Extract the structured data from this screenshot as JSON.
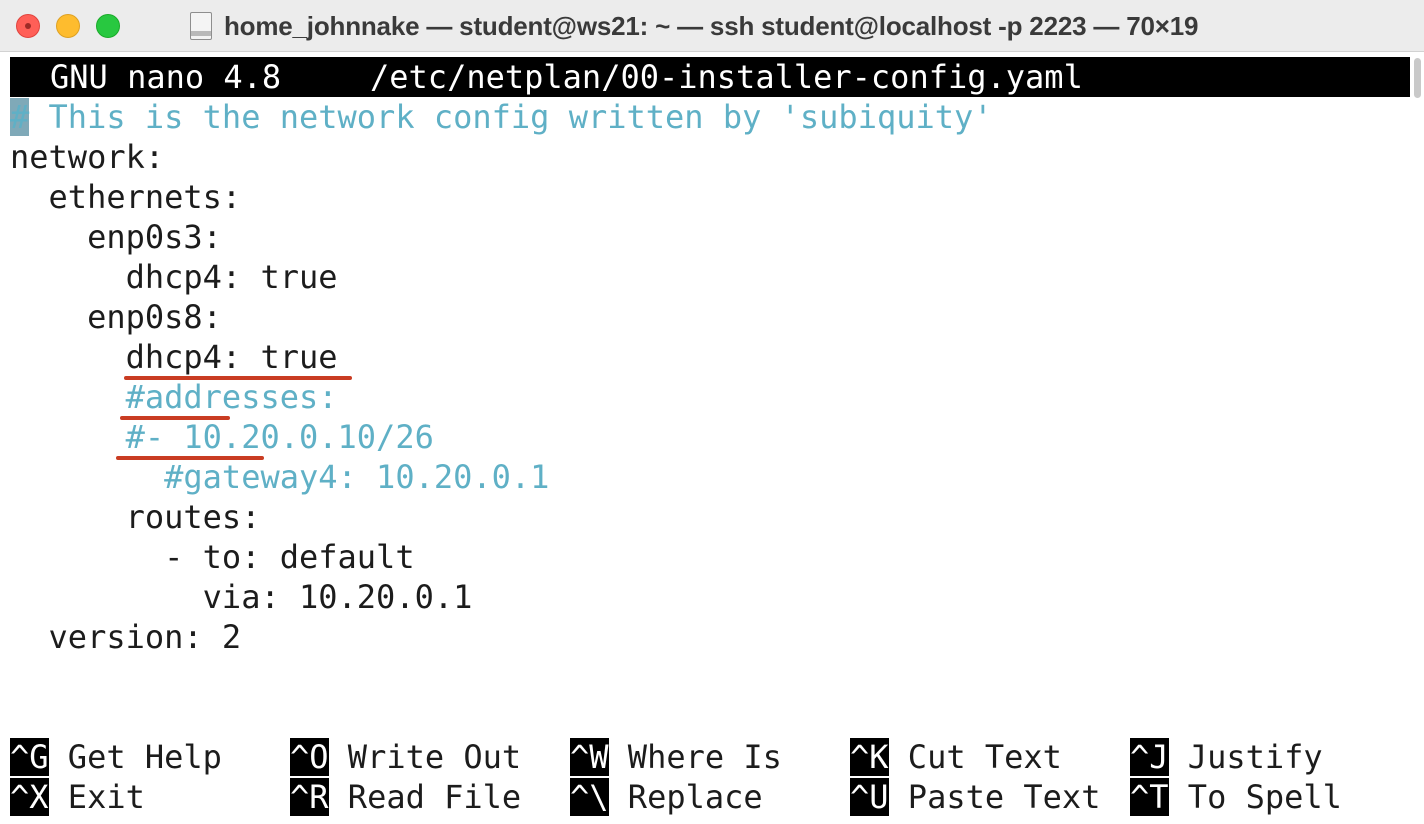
{
  "window": {
    "title": "home_johnnake — student@ws21: ~ — ssh student@localhost -p 2223 — 70×19",
    "icon": "document-icon",
    "traffic_lights": {
      "close": "#ff5f57",
      "minimize": "#febc2e",
      "zoom": "#28c840"
    }
  },
  "nano": {
    "version_label": "GNU nano 4.8",
    "file_path": "/etc/netplan/00-installer-config.yaml"
  },
  "editor": {
    "lines": [
      {
        "prefix": "#",
        "text": " This is the network config written by 'subiquity'",
        "kind": "comment-with-cursor"
      },
      {
        "text": "network:",
        "kind": "code"
      },
      {
        "text": "  ethernets:",
        "kind": "code"
      },
      {
        "text": "    enp0s3:",
        "kind": "code"
      },
      {
        "text": "      dhcp4: true",
        "kind": "code"
      },
      {
        "text": "    enp0s8:",
        "kind": "code"
      },
      {
        "text": "      dhcp4: true",
        "kind": "code"
      },
      {
        "text": "      #addresses:",
        "kind": "comment"
      },
      {
        "text": "      #- 10.20.0.10/26",
        "kind": "comment"
      },
      {
        "text": "        #gateway4: 10.20.0.1",
        "kind": "comment"
      },
      {
        "text": "      routes:",
        "kind": "code"
      },
      {
        "text": "        - to: default",
        "kind": "code"
      },
      {
        "text": "          via: 10.20.0.1",
        "kind": "code"
      },
      {
        "text": "  version: 2",
        "kind": "code"
      }
    ]
  },
  "shortcuts": {
    "row1": [
      {
        "key": "^G",
        "label": " Get Help"
      },
      {
        "key": "^O",
        "label": " Write Out"
      },
      {
        "key": "^W",
        "label": " Where Is"
      },
      {
        "key": "^K",
        "label": " Cut Text"
      },
      {
        "key": "^J",
        "label": " Justify"
      }
    ],
    "row2": [
      {
        "key": "^X",
        "label": " Exit"
      },
      {
        "key": "^R",
        "label": " Read File"
      },
      {
        "key": "^\\",
        "label": " Replace"
      },
      {
        "key": "^U",
        "label": " Paste Text"
      },
      {
        "key": "^T",
        "label": " To Spell"
      }
    ]
  },
  "colors": {
    "comment": "#5fb0c6",
    "text": "#1c1c1c",
    "annotation_underline": "#c93c22",
    "header_bg": "#000000"
  }
}
